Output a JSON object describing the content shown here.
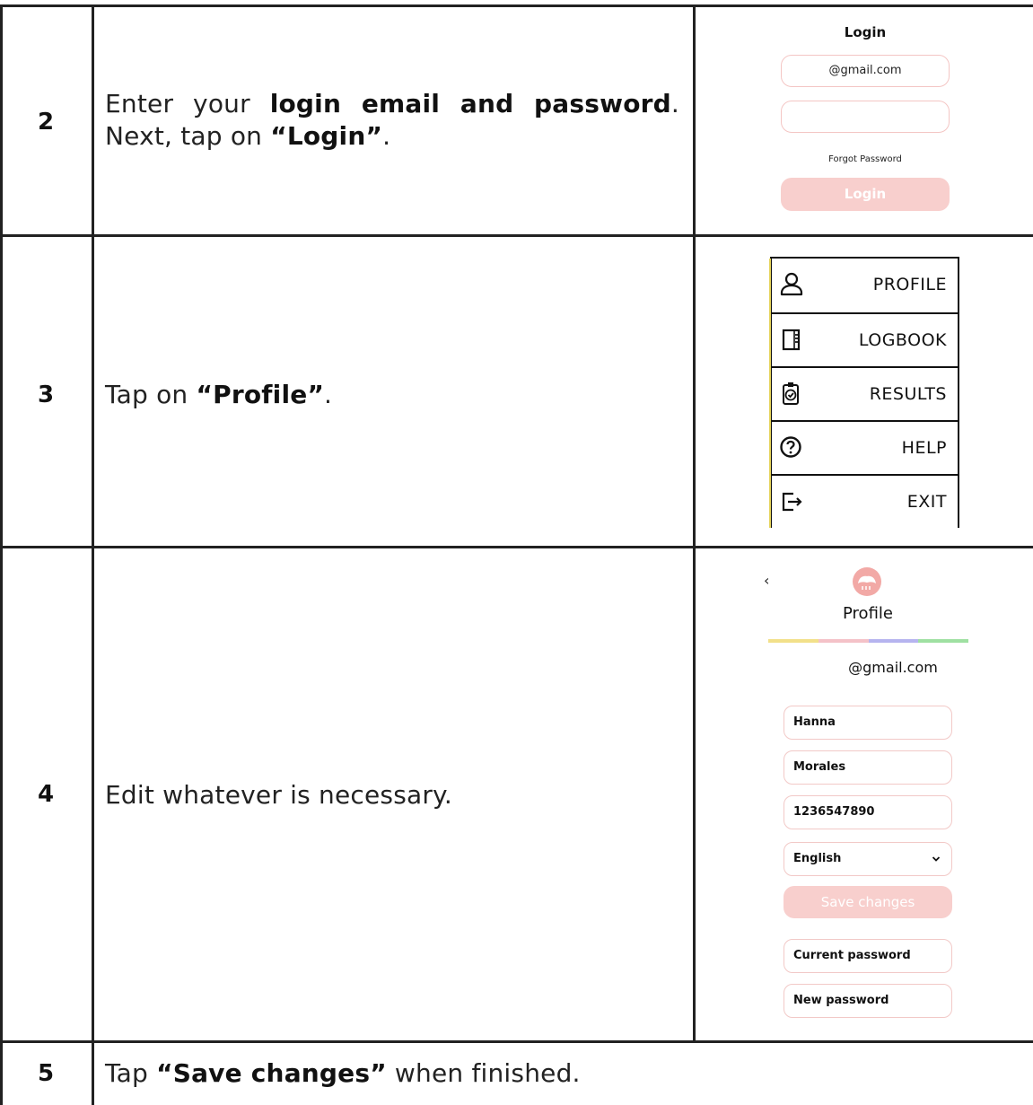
{
  "rows": [
    {
      "step": "2",
      "text_parts": [
        "Enter your ",
        "login email and password",
        ". Next, tap on ",
        "“",
        "Login",
        "”",
        "."
      ]
    },
    {
      "step": "3",
      "text_parts": [
        "Tap on ",
        "“",
        "Profile",
        "”",
        "."
      ]
    },
    {
      "step": "4",
      "text": "Edit whatever is necessary."
    },
    {
      "step": "5",
      "text_parts": [
        "Tap ",
        "“Save changes”",
        " when finished."
      ]
    }
  ],
  "login_screen": {
    "title": "Login",
    "email_value": "@gmail.com",
    "password_value": "",
    "forgot_link": "Forgot Password",
    "login_button": "Login"
  },
  "menu_screen": {
    "items": [
      {
        "label": "PROFILE",
        "icon": "person-icon"
      },
      {
        "label": "LOGBOOK",
        "icon": "notebook-icon"
      },
      {
        "label": "RESULTS",
        "icon": "clipboard-check-icon"
      },
      {
        "label": "HELP",
        "icon": "question-circle-icon"
      },
      {
        "label": "EXIT",
        "icon": "exit-icon"
      }
    ]
  },
  "profile_screen": {
    "back": "‹",
    "title": "Profile",
    "email": "@gmail.com",
    "first_name": "Hanna",
    "last_name": "Morales",
    "phone": "1236547890",
    "language": "English",
    "save_button": "Save changes",
    "current_password_placeholder": "Current password",
    "new_password_placeholder": "New password"
  },
  "colors": {
    "accent_pink": "#f8cfcd",
    "field_border": "#f2c9c7",
    "rainbow": [
      "#f2e08a",
      "#f4c2c8",
      "#b6b4ef",
      "#9fe0a2"
    ]
  }
}
